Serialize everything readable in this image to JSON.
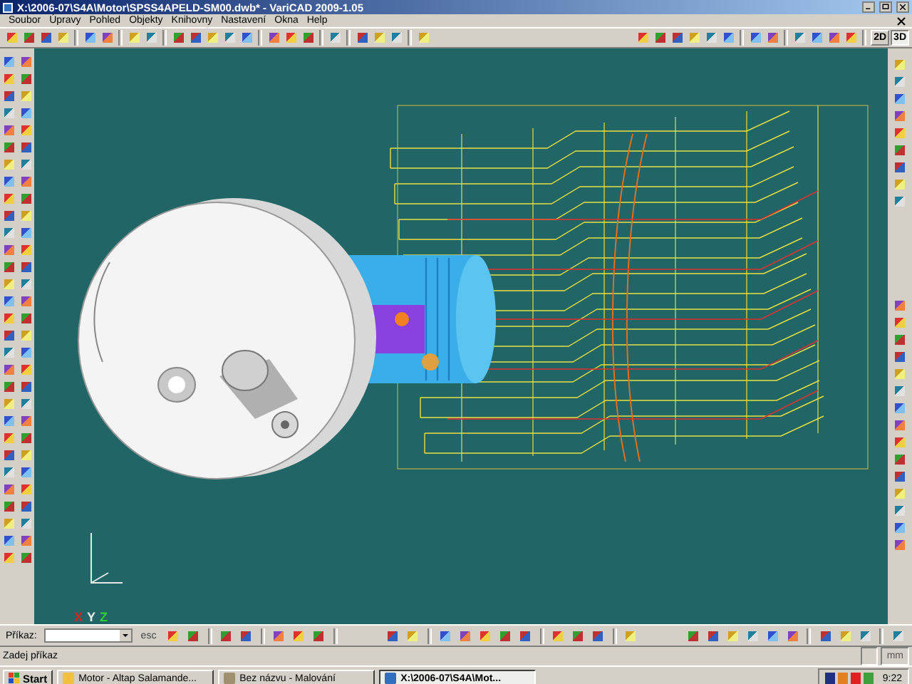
{
  "window": {
    "title": "X:\\2006-07\\S4A\\Motor\\SPSS4APELD-SM00.dwb* - VariCAD 2009-1.05"
  },
  "menu": [
    "Soubor",
    "Úpravy",
    "Pohled",
    "Objekty",
    "Knihovny",
    "Nastavení",
    "Okna",
    "Help"
  ],
  "view_modes": [
    {
      "label": "2D",
      "selected": false
    },
    {
      "label": "3D",
      "selected": true
    }
  ],
  "axes": [
    {
      "label": "X",
      "color": "#e02020"
    },
    {
      "label": "Y",
      "color": "#e8e8e8"
    },
    {
      "label": "Z",
      "color": "#30d030"
    }
  ],
  "command_bar": {
    "label": "Příkaz:",
    "escape": "esc"
  },
  "status_bar": {
    "prompt": "Zadej příkaz",
    "units": "mm"
  },
  "taskbar": {
    "start": "Start",
    "tasks": [
      {
        "label": "Motor - Altap Salamande...",
        "selected": false
      },
      {
        "label": "Bez názvu - Malování",
        "selected": false
      },
      {
        "label": "X:\\2006-07\\S4A\\Mot...",
        "selected": true
      }
    ],
    "clock": "9:22"
  }
}
